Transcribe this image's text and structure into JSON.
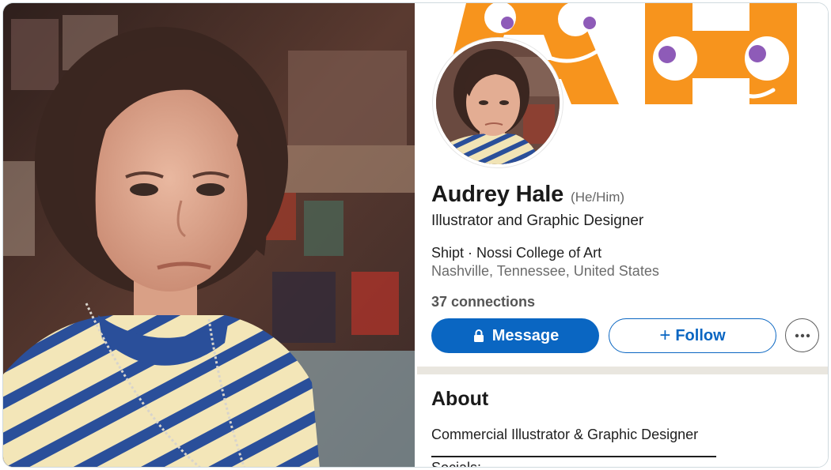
{
  "photo": {
    "description_icon": "person-portrait-icon"
  },
  "profile": {
    "name": "Audrey Hale",
    "pronouns": "(He/Him)",
    "headline": "Illustrator and Graphic Designer",
    "company_line": "Shipt · Nossi College of Art",
    "location": "Nashville, Tennessee, United States",
    "connections": "37 connections"
  },
  "actions": {
    "message_label": "Message",
    "message_icon": "lock-icon",
    "follow_label": "Follow",
    "follow_icon": "plus-icon",
    "more_icon": "more-horizontal-icon"
  },
  "about": {
    "title": "About",
    "text": "Commercial Illustrator & Graphic Designer",
    "socials_label": "Socials:"
  },
  "colors": {
    "primary": "#0a66c2",
    "banner_orange": "#f7941d",
    "banner_purple": "#8e5bb8"
  }
}
